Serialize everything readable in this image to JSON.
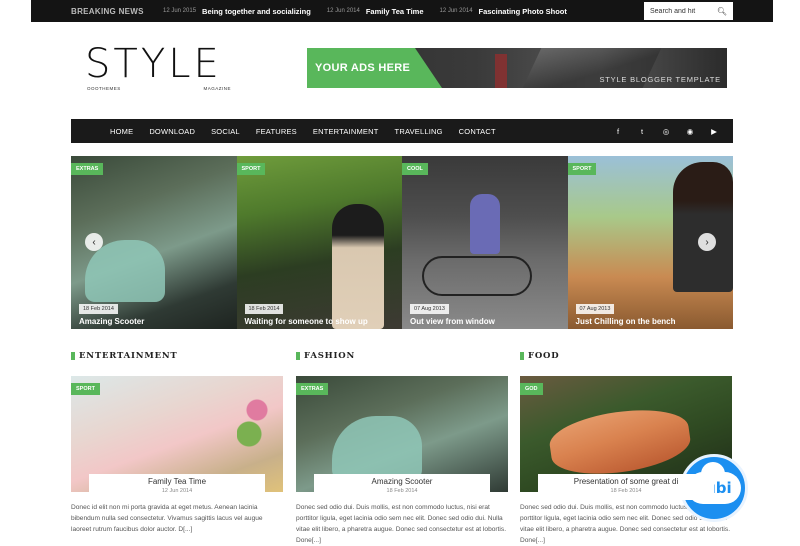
{
  "topbar": {
    "label": "Breaking News",
    "items": [
      {
        "date": "12 Jun 2015",
        "title": "Being together and socializing"
      },
      {
        "date": "12 Jun 2014",
        "title": "Family Tea Time"
      },
      {
        "date": "12 Jun 2014",
        "title": "Fascinating Photo Shoot"
      }
    ],
    "search_placeholder": "Search and hit"
  },
  "logo": {
    "main": "STYLE",
    "left_sub": "OOOTHEMES",
    "right_sub": "MAGAZINE"
  },
  "ad": {
    "headline": "YOUR ADS HERE",
    "tagline": "Style Blogger Template"
  },
  "nav": {
    "items": [
      "Home",
      "Download",
      "Social",
      "Features",
      "Entertainment",
      "Travelling",
      "Contact"
    ],
    "social": [
      "f",
      "t",
      "◎",
      "◉",
      "▶"
    ]
  },
  "slides": [
    {
      "category": "Extras",
      "date": "18 Feb 2014",
      "title": "Amazing Scooter"
    },
    {
      "category": "Sport",
      "date": "18 Feb 2014",
      "title": "Waiting for someone to show up"
    },
    {
      "category": "Cool",
      "date": "07 Aug 2013",
      "title": "Out view from window"
    },
    {
      "category": "Sport",
      "date": "07 Aug 2013",
      "title": "Just Chilling on the bench"
    }
  ],
  "slider_controls": {
    "prev": "‹",
    "next": "›"
  },
  "sections": [
    {
      "heading": "Entertainment",
      "card": {
        "category": "Sport",
        "title": "Family Tea Time",
        "date": "12 Jun 2014",
        "excerpt": "Donec id elit non mi porta gravida at eget metus. Aenean lacinia bibendum nulla sed consectetur. Vivamus sagittis lacus vel augue laoreet rutrum faucibus dolor auctor. D[...]"
      }
    },
    {
      "heading": "Fashion",
      "card": {
        "category": "Extras",
        "title": "Amazing Scooter",
        "date": "18 Feb 2014",
        "excerpt": "Donec sed odio dui. Duis mollis, est non commodo luctus, nisi erat porttitor ligula, eget lacinia odio sem nec elit. Donec sed odio dui. Nulla vitae elit libero, a pharetra augue. Donec sed consectetur est at lobortis. Done[...]"
      }
    },
    {
      "heading": "Food",
      "card": {
        "category": "God",
        "title": "Presentation of some great di",
        "date": "18 Feb 2014",
        "excerpt": "Donec sed odio dui. Duis mollis, est non commodo luctus, nisi erat porttitor ligula, eget lacinia odio sem nec elit. Donec sed odio dui. Nulla vitae elit libero, a pharetra augue. Donec sed consectetur est at lobortis. Done[...]"
      }
    }
  ],
  "badge": {
    "text": "zubi"
  },
  "colors": {
    "accent": "#59b75b",
    "nav": "#1a1a1a",
    "topbar": "#141414",
    "badge": "#1c8ff0"
  }
}
